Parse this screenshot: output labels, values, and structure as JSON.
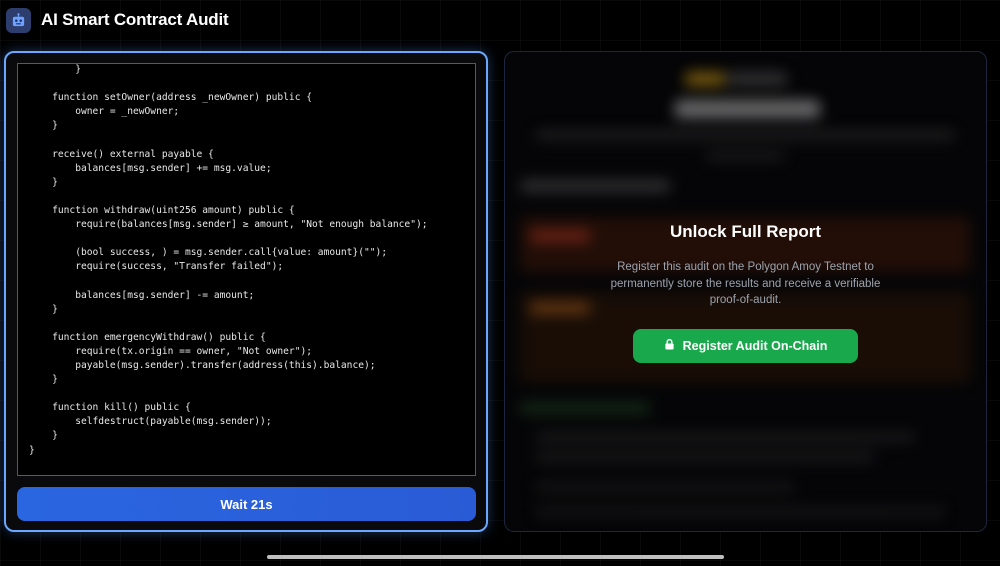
{
  "header": {
    "title": "AI Smart Contract Audit",
    "logo_icon": "robot-icon"
  },
  "code": {
    "lines": [
      "        }",
      "",
      "    function setOwner(address _newOwner) public {",
      "        owner = _newOwner;",
      "    }",
      "",
      "    receive() external payable {",
      "        balances[msg.sender] += msg.value;",
      "    }",
      "",
      "    function withdraw(uint256 amount) public {",
      "        require(balances[msg.sender] ≥ amount, \"Not enough balance\");",
      "",
      "        (bool success, ) = msg.sender.call{value: amount}(\"\");",
      "        require(success, \"Transfer failed\");",
      "",
      "        balances[msg.sender] -= amount;",
      "    }",
      "",
      "    function emergencyWithdraw() public {",
      "        require(tx.origin == owner, \"Not owner\");",
      "        payable(msg.sender).transfer(address(this).balance);",
      "    }",
      "",
      "    function kill() public {",
      "        selfdestruct(payable(msg.sender));",
      "    }",
      "}"
    ]
  },
  "wait_button": {
    "label": "Wait 21s"
  },
  "unlock": {
    "title": "Unlock Full Report",
    "description": "Register this audit on the Polygon Amoy Testnet to permanently store the results and receive a verifiable proof-of-audit.",
    "button_label": "Register Audit On-Chain",
    "button_icon": "lock-icon"
  },
  "colors": {
    "primary_blue": "#2a66e0",
    "success_green": "#1aa84d",
    "focus_border": "#6aa8ff"
  }
}
